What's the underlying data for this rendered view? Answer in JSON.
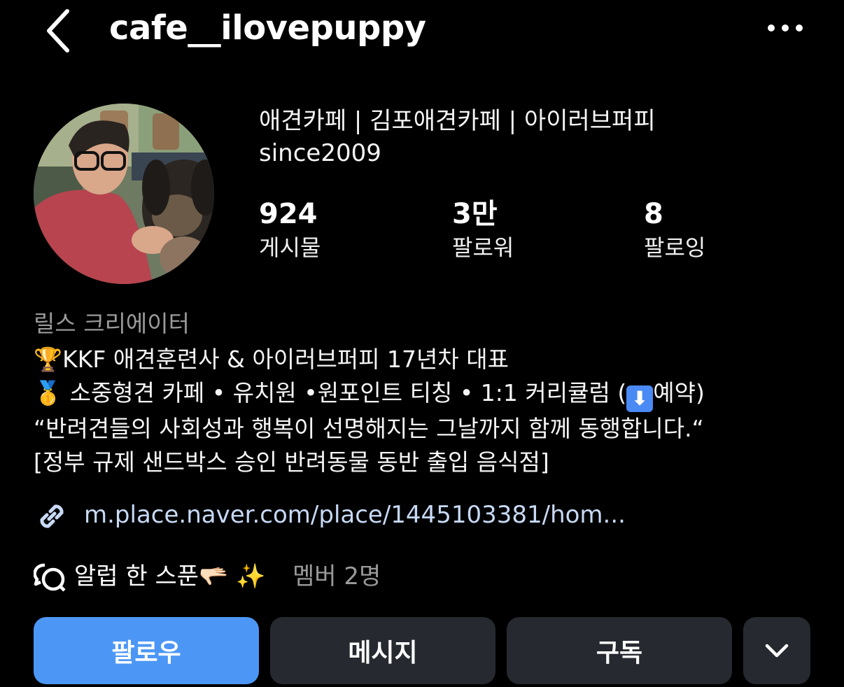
{
  "header": {
    "username": "cafe__ilovepuppy"
  },
  "profile": {
    "full_name_line1": "애견카페 | 김포애견카페 | 아이러브퍼피",
    "full_name_line2": "since2009",
    "stats": [
      {
        "value": "924",
        "label": "게시물"
      },
      {
        "value": "3만",
        "label": "팔로워"
      },
      {
        "value": "8",
        "label": "팔로잉"
      }
    ],
    "category": "릴스 크리에이터",
    "bio": {
      "line1_emoji": "🏆",
      "line1_text": "KKF 애견훈련사 & 아이러브퍼피 17년차 대표",
      "line2_emoji": "🥇",
      "line2_text": " 소중형견 카페 • 유치원 •원포인트 티칭 • 1:1 커리큘럼 (",
      "line2_arrow": "⬇",
      "line2_suffix": "예약)",
      "line3": "“반려견들의 사회성과 행복이 선명해지는 그날까지 함께 동행합니다.“",
      "line4": "[정부 규제 샌드박스 승인 반려동물 동반 출입 음식점]"
    },
    "link": "m.place.naver.com/place/1445103381/hom...",
    "channel": {
      "name": "알럽 한 스푼🫳🏻 ✨",
      "members": "멤버 2명"
    }
  },
  "actions": {
    "follow": "팔로우",
    "message": "메시지",
    "subscribe": "구독"
  },
  "colors": {
    "background": "#000000",
    "follow_button": "#4c97f5",
    "secondary_button": "#262a30",
    "link": "#c7d9f5",
    "muted_text": "#9a9a9a"
  },
  "icons": {
    "back": "chevron-left-icon",
    "more": "more-horizontal-icon",
    "link": "link-icon",
    "channel": "chat-bubbles-icon",
    "dropdown": "chevron-down-icon"
  }
}
